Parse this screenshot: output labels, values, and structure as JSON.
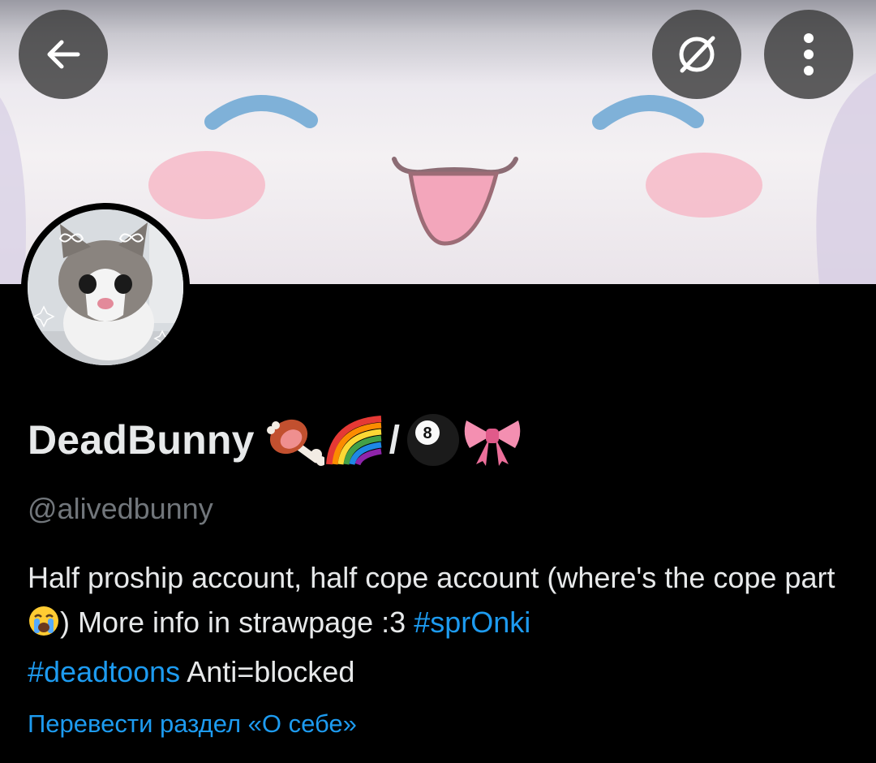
{
  "header": {
    "back_button": "arrow-left-icon",
    "grok_button": "grok-icon",
    "more_button": "more-vertical-icon"
  },
  "profile": {
    "display_name": "DeadBunny",
    "name_emoji": [
      "meat-on-bone-emoji",
      "rainbow-emoji",
      "/",
      "8-ball-emoji",
      "ribbon-emoji"
    ],
    "slash": "/",
    "handle": "@alivedbunny",
    "bio": {
      "part1": "Half proship account, half cope account (where's the cope part ",
      "emoji": "loudly-crying-face-emoji",
      "part2": ") More info in strawpage :3 ",
      "hashtag1": "#sprOnki",
      "hashtag2": "#deadtoons",
      "part3": " Anti=blocked"
    },
    "translate_link": "Перевести раздел «О себе»"
  },
  "colors": {
    "background": "#000000",
    "text": "#e7e9ea",
    "secondary_text": "#71767b",
    "link": "#1d9bf0"
  }
}
